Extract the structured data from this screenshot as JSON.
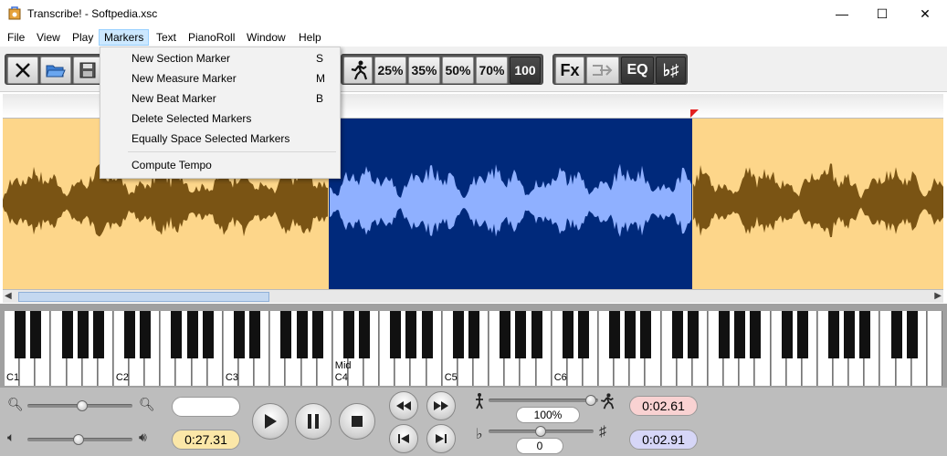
{
  "window": {
    "title": "Transcribe! - Softpedia.xsc",
    "minimize": "—",
    "maximize": "☐",
    "close": "✕"
  },
  "menubar": {
    "items": [
      "File",
      "View",
      "Play",
      "Markers",
      "Text",
      "PianoRoll",
      "Window",
      "Help"
    ],
    "active": "Markers"
  },
  "markers_menu": {
    "items": [
      {
        "label": "New Section Marker",
        "shortcut": "S"
      },
      {
        "label": "New Measure Marker",
        "shortcut": "M"
      },
      {
        "label": "New Beat Marker",
        "shortcut": "B"
      },
      {
        "label": "Delete Selected Markers",
        "shortcut": ""
      },
      {
        "label": "Equally Space Selected Markers",
        "shortcut": ""
      },
      {
        "label": "Compute Tempo",
        "shortcut": ""
      }
    ]
  },
  "toolbar": {
    "speed_presets": [
      "25%",
      "35%",
      "50%",
      "70%",
      "100"
    ],
    "active_speed": "100",
    "fx_label": "Fx",
    "eq_label": "EQ",
    "key_label": "♭♯"
  },
  "keyboard": {
    "octave_labels": [
      "C1",
      "C2",
      "C3",
      "C4",
      "C5",
      "C6"
    ],
    "middle_label": "Mid"
  },
  "controls": {
    "elapsed_time": "0:27.31",
    "speed_value": "100%",
    "pitch_value": "0",
    "selection_start": "0:02.61",
    "selection_end": "0:02.91",
    "colors": {
      "start_bg": "#f9d2d2",
      "end_bg": "#d6d6f7",
      "elapsed_bg": "#fbe7a8"
    }
  },
  "waveform": {
    "colors": {
      "background": "#fdd68a",
      "wave": "#7a5414",
      "selection_bg": "#00297b",
      "selection_wave": "#8fb0ff"
    }
  }
}
